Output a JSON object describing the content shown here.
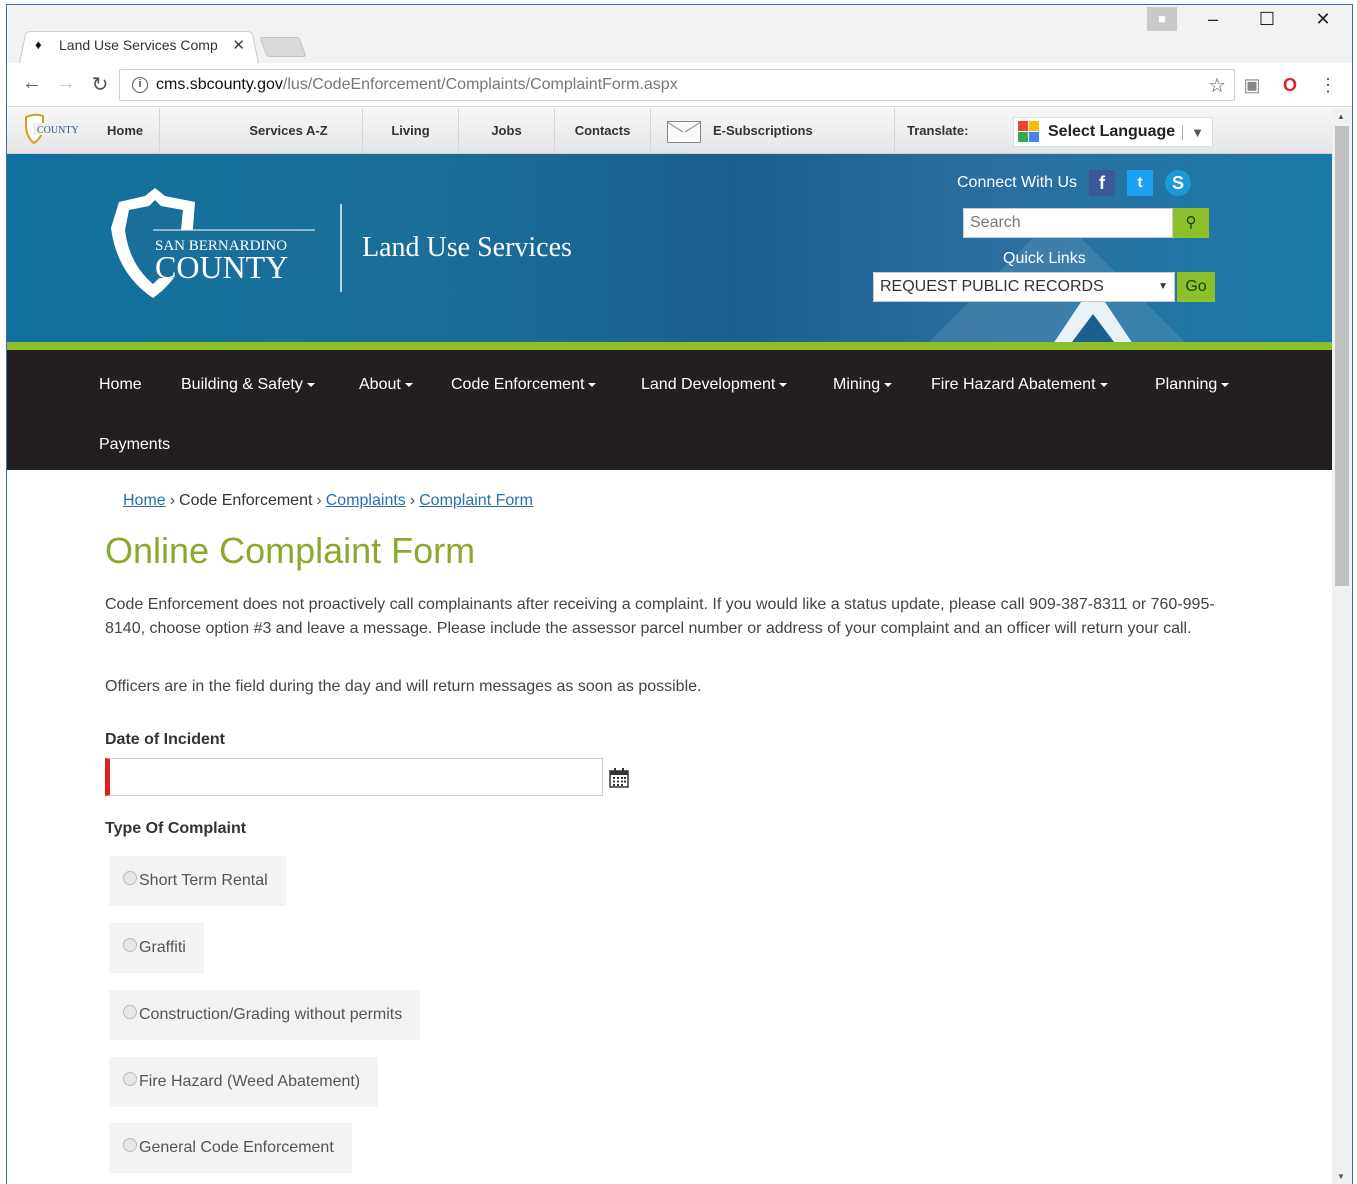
{
  "browser": {
    "tab_title": "Land Use Services Comp",
    "url_host": "cms.sbcounty.gov",
    "url_path": "/lus/CodeEnforcement/Complaints/ComplaintForm.aspx"
  },
  "utility_bar": {
    "logo_text": "COUNTY",
    "items": [
      "Home",
      "Services A-Z",
      "Living",
      "Jobs",
      "Contacts",
      "E-Subscriptions"
    ],
    "translate_label": "Translate:",
    "language_select": "Select Language"
  },
  "banner": {
    "county_line1": "SAN BERNARDINO",
    "county_line2": "COUNTY",
    "department": "Land Use Services",
    "connect_label": "Connect With Us",
    "search_placeholder": "Search",
    "quick_links_label": "Quick Links",
    "quick_links_selected": "REQUEST PUBLIC RECORDS",
    "go_label": "Go"
  },
  "main_nav": {
    "items": [
      "Home",
      "Building & Safety",
      "About",
      "Code Enforcement",
      "Land Development",
      "Mining",
      "Fire Hazard Abatement",
      "Planning",
      "Payments"
    ]
  },
  "breadcrumb": {
    "home": "Home",
    "section": "Code Enforcement",
    "complaints": "Complaints",
    "current": "Complaint Form"
  },
  "content": {
    "title": "Online Complaint Form",
    "intro": "Code Enforcement does not proactively call complainants after receiving a complaint. If you would like a status update, please call 909-387-8311 or 760-995-8140, choose option #3 and leave a message. Please include the assessor parcel number or address of your complaint and an officer will return your call.",
    "intro2": "Officers are in the field during the day and will return messages as soon as possible.",
    "date_label": "Date of Incident",
    "date_value": "",
    "type_label": "Type Of Complaint",
    "complaint_types": [
      "Short Term Rental",
      "Graffiti",
      "Construction/Grading without permits",
      "Fire Hazard (Weed Abatement)",
      "General Code Enforcement"
    ]
  },
  "colors": {
    "title_green": "#8aaa2e",
    "accent_green": "#8dbf2a",
    "nav_bg": "#231f20",
    "banner_blue": "#1a6f9a",
    "link_blue": "#2a6fb0",
    "required_red": "#e02020"
  }
}
